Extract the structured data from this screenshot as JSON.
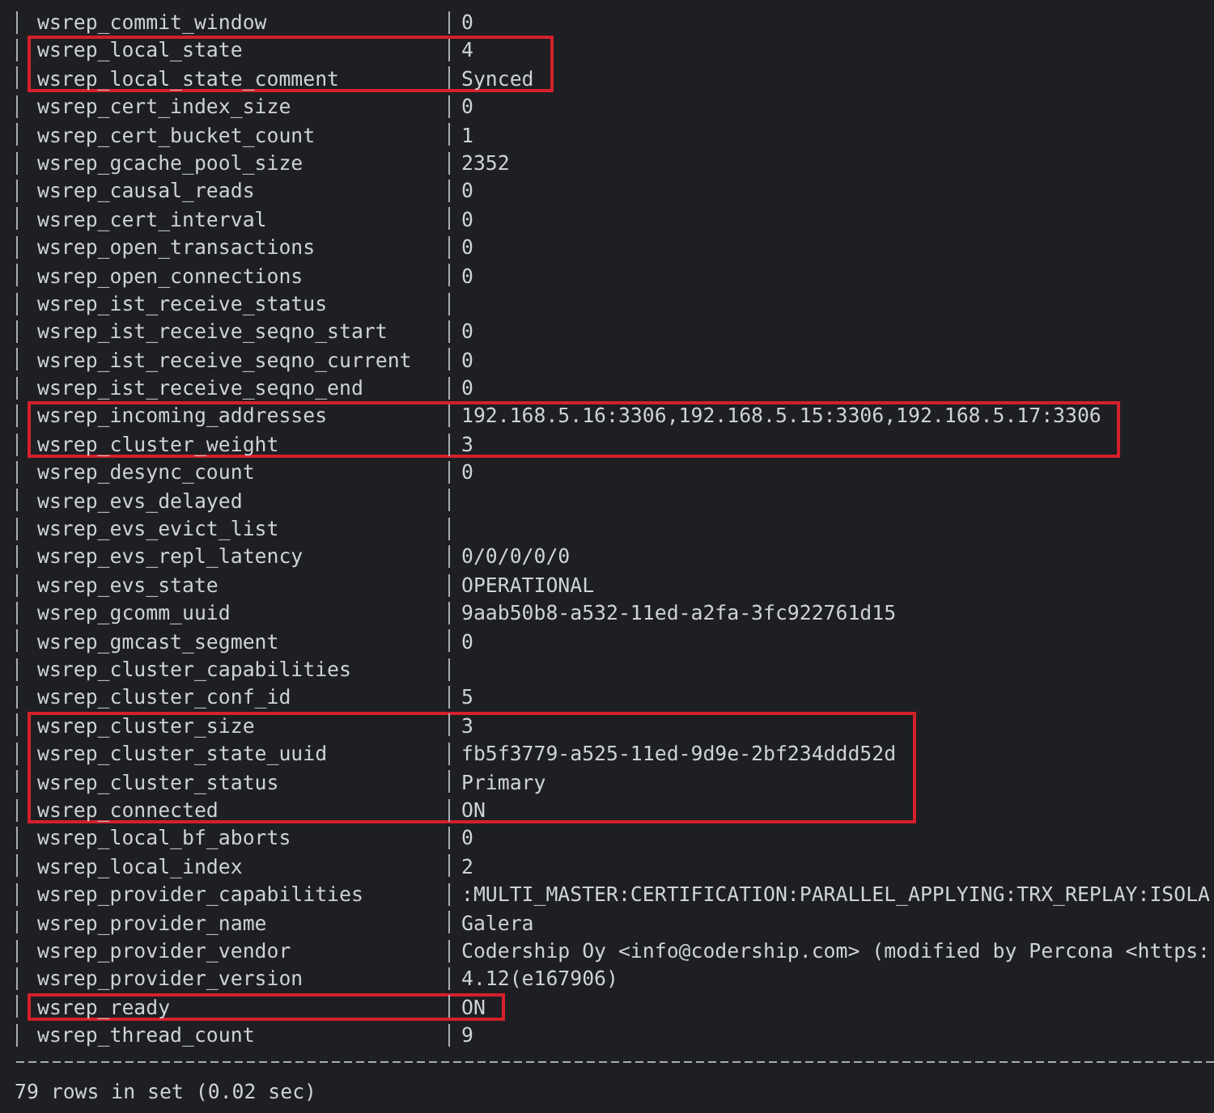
{
  "rows": [
    {
      "name": "wsrep_commit_window",
      "value": "0",
      "highlighted": false
    },
    {
      "name": "wsrep_local_state",
      "value": "4",
      "highlighted": true
    },
    {
      "name": "wsrep_local_state_comment",
      "value": "Synced",
      "highlighted": true
    },
    {
      "name": "wsrep_cert_index_size",
      "value": "0",
      "highlighted": false
    },
    {
      "name": "wsrep_cert_bucket_count",
      "value": "1",
      "highlighted": false
    },
    {
      "name": "wsrep_gcache_pool_size",
      "value": "2352",
      "highlighted": false
    },
    {
      "name": "wsrep_causal_reads",
      "value": "0",
      "highlighted": false
    },
    {
      "name": "wsrep_cert_interval",
      "value": "0",
      "highlighted": false
    },
    {
      "name": "wsrep_open_transactions",
      "value": "0",
      "highlighted": false
    },
    {
      "name": "wsrep_open_connections",
      "value": "0",
      "highlighted": false
    },
    {
      "name": "wsrep_ist_receive_status",
      "highlighted": false
    },
    {
      "name": "wsrep_ist_receive_seqno_start",
      "value": "0",
      "highlighted": false
    },
    {
      "name": "wsrep_ist_receive_seqno_current",
      "value": "0",
      "highlighted": false
    },
    {
      "name": "wsrep_ist_receive_seqno_end",
      "value": "0",
      "highlighted": false
    },
    {
      "name": "wsrep_incoming_addresses",
      "value": "192.168.5.16:3306,192.168.5.15:3306,192.168.5.17:3306",
      "highlighted": true
    },
    {
      "name": "wsrep_cluster_weight",
      "value": "3",
      "highlighted": true
    },
    {
      "name": "wsrep_desync_count",
      "value": "0",
      "highlighted": false
    },
    {
      "name": "wsrep_evs_delayed",
      "highlighted": false
    },
    {
      "name": "wsrep_evs_evict_list",
      "highlighted": false
    },
    {
      "name": "wsrep_evs_repl_latency",
      "value": "0/0/0/0/0",
      "highlighted": false
    },
    {
      "name": "wsrep_evs_state",
      "value": "OPERATIONAL",
      "highlighted": false
    },
    {
      "name": "wsrep_gcomm_uuid",
      "value": "9aab50b8-a532-11ed-a2fa-3fc922761d15",
      "highlighted": false
    },
    {
      "name": "wsrep_gmcast_segment",
      "value": "0",
      "highlighted": false
    },
    {
      "name": "wsrep_cluster_capabilities",
      "highlighted": false
    },
    {
      "name": "wsrep_cluster_conf_id",
      "value": "5",
      "highlighted": false
    },
    {
      "name": "wsrep_cluster_size",
      "value": "3",
      "highlighted": true
    },
    {
      "name": "wsrep_cluster_state_uuid",
      "value": "fb5f3779-a525-11ed-9d9e-2bf234ddd52d",
      "highlighted": true
    },
    {
      "name": "wsrep_cluster_status",
      "value": "Primary",
      "highlighted": true
    },
    {
      "name": "wsrep_connected",
      "value": "ON",
      "highlighted": true
    },
    {
      "name": "wsrep_local_bf_aborts",
      "value": "0",
      "highlighted": false
    },
    {
      "name": "wsrep_local_index",
      "value": "2",
      "highlighted": false
    },
    {
      "name": "wsrep_provider_capabilities",
      "value": ":MULTI_MASTER:CERTIFICATION:PARALLEL_APPLYING:TRX_REPLAY:ISOLA",
      "highlighted": false
    },
    {
      "name": "wsrep_provider_name",
      "value": "Galera",
      "highlighted": false
    },
    {
      "name": "wsrep_provider_vendor",
      "value": "Codership Oy <info@codership.com> (modified by Percona <https:",
      "highlighted": false
    },
    {
      "name": "wsrep_provider_version",
      "value": "4.12(e167906)",
      "highlighted": false
    },
    {
      "name": "wsrep_ready",
      "value": "ON",
      "highlighted": true
    },
    {
      "name": "wsrep_thread_count",
      "value": "9",
      "highlighted": false
    }
  ],
  "footer": "79 rows in set (0.02 sec)"
}
